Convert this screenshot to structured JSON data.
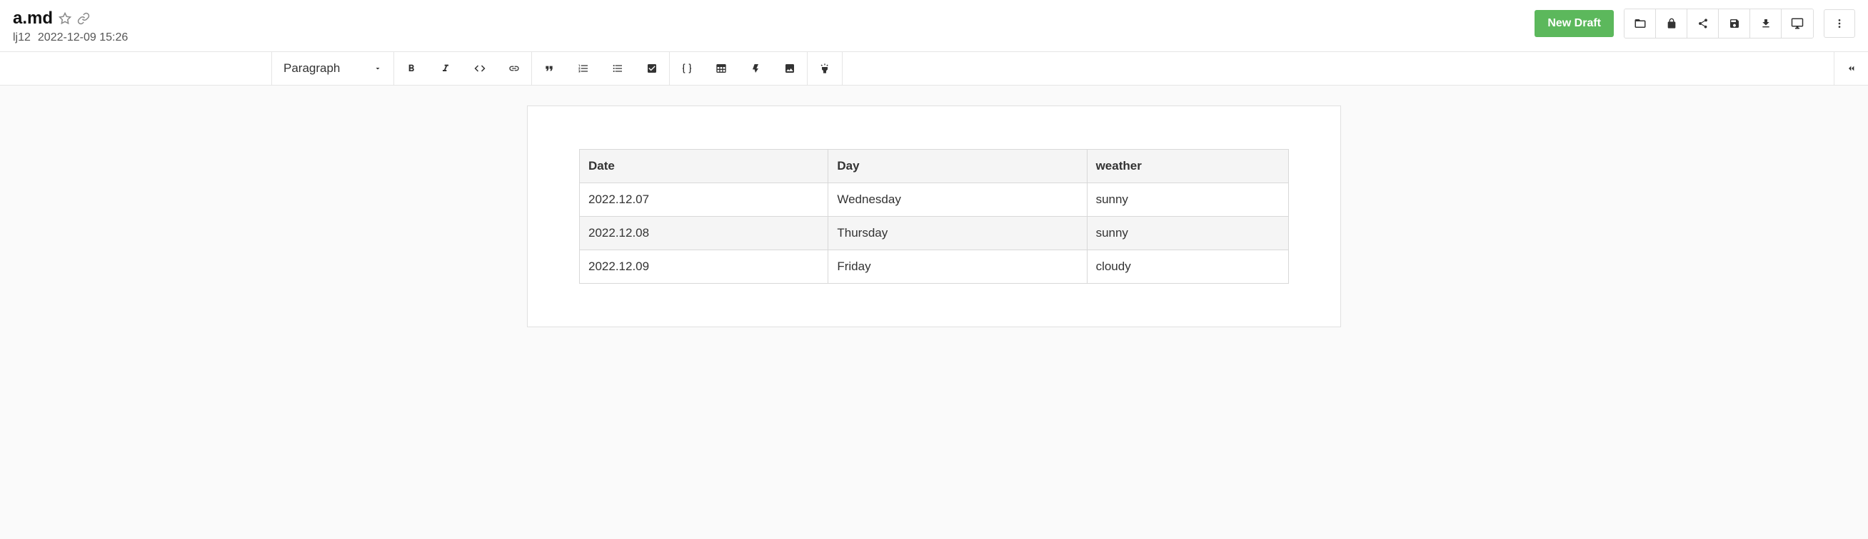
{
  "header": {
    "title": "a.md",
    "author": "lj12",
    "timestamp": "2022-12-09 15:26",
    "new_draft_label": "New Draft"
  },
  "toolbar": {
    "format_label": "Paragraph"
  },
  "table": {
    "headers": [
      "Date",
      "Day",
      "weather"
    ],
    "rows": [
      [
        "2022.12.07",
        "Wednesday",
        "sunny"
      ],
      [
        "2022.12.08",
        "Thursday",
        "sunny"
      ],
      [
        "2022.12.09",
        "Friday",
        "cloudy"
      ]
    ]
  }
}
